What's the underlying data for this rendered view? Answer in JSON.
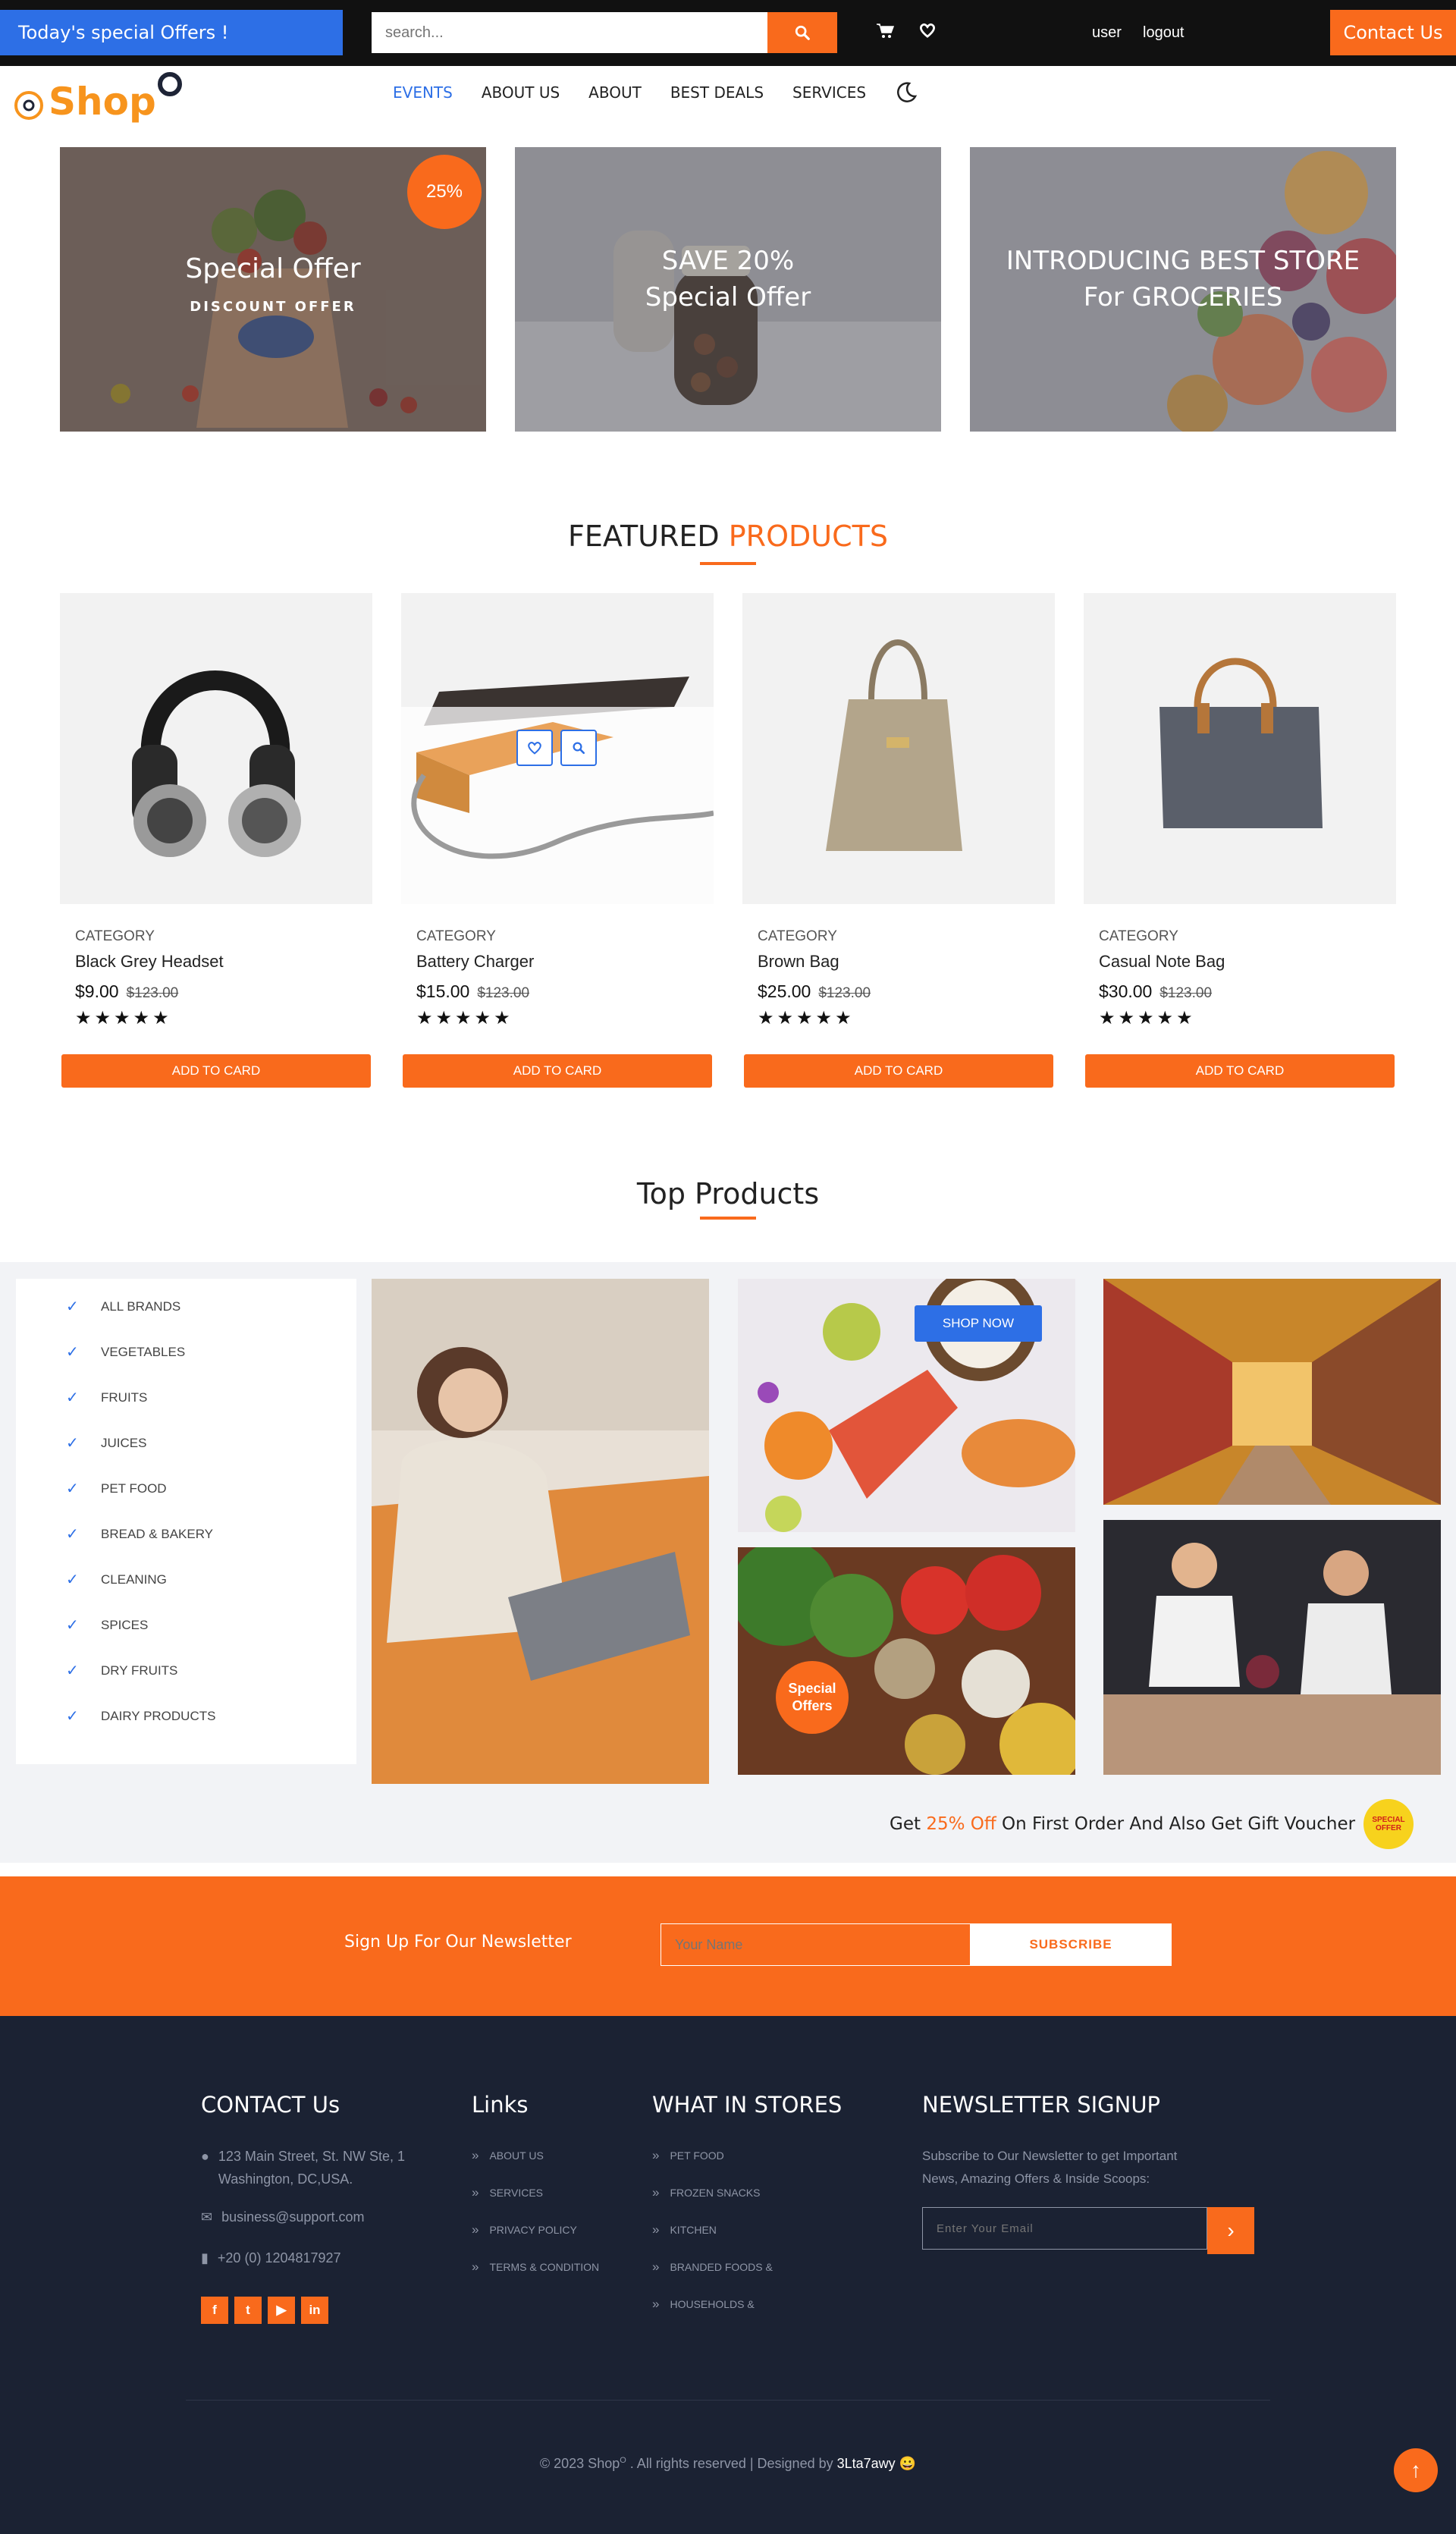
{
  "topbar": {
    "offer_tag": "Today's special Offers !",
    "search_placeholder": "search...",
    "user_label": "user",
    "logout_label": "logout",
    "contact_label": "Contact Us"
  },
  "nav": {
    "logo_text": "Shop",
    "items": [
      "EVENTS",
      "ABOUT US",
      "ABOUT",
      "BEST DEALS",
      "SERVICES"
    ],
    "active_item": "EVENTS"
  },
  "banners": [
    {
      "title": "Special Offer",
      "subtitle": "DISCOUNT OFFER",
      "badge": "25%"
    },
    {
      "title": "SAVE 20%",
      "subtitle": "Special Offer"
    },
    {
      "title": "INTRODUCING BEST STORE",
      "subtitle": "For GROCERIES"
    }
  ],
  "featured": {
    "title_part1": "FEATURED",
    "title_part2": "PRODUCTS",
    "products": [
      {
        "category": "CATEGORY",
        "name": "Black Grey Headset",
        "price": "$9.00",
        "old_price": "$123.00",
        "stars": "★★★★★",
        "button": "ADD TO CARD"
      },
      {
        "category": "CATEGORY",
        "name": "Battery Charger",
        "price": "$15.00",
        "old_price": "$123.00",
        "stars": "★★★★★",
        "button": "ADD TO CARD"
      },
      {
        "category": "CATEGORY",
        "name": "Brown Bag",
        "price": "$25.00",
        "old_price": "$123.00",
        "stars": "★★★★★",
        "button": "ADD TO CARD"
      },
      {
        "category": "CATEGORY",
        "name": "Casual Note Bag",
        "price": "$30.00",
        "old_price": "$123.00",
        "stars": "★★★★★",
        "button": "ADD TO CARD"
      }
    ]
  },
  "top_products": {
    "title": "Top Products",
    "categories": [
      "ALL BRANDS",
      "VEGETABLES",
      "FRUITS",
      "JUICES",
      "PET FOOD",
      "BREAD & BAKERY",
      "CLEANING",
      "SPICES",
      "DRY FRUITS",
      "DAIRY PRODUCTS"
    ],
    "shop_now": "SHOP NOW",
    "special_badge_line1": "Special",
    "special_badge_line2": "Offers",
    "promo_pre": "Get",
    "promo_highlight": "25% Off",
    "promo_post": "On First Order And Also Get Gift Voucher",
    "seal_line1": "SPECIAL",
    "seal_line2": "OFFER"
  },
  "newsletter": {
    "label": "Sign Up For Our Newsletter",
    "placeholder": "Your Name",
    "button": "SUBSCRIBE"
  },
  "footer": {
    "contact_title": "CONTACT Us",
    "address_line1": "123 Main Street, St. NW Ste, 1",
    "address_line2": "Washington, DC,USA.",
    "email": "business@support.com",
    "phone": "+20 (0) 1204817927",
    "links_title": "Links",
    "links": [
      "ABOUT US",
      "SERVICES",
      "PRIVACY POLICY",
      "TERMS & CONDITION"
    ],
    "stores_title": "WHAT IN STORES",
    "stores": [
      "PET FOOD",
      "FROZEN SNACKS",
      "KITCHEN",
      "BRANDED FOODS &",
      "HOUSEHOLDS &"
    ],
    "signup_title": "NEWSLETTER SIGNUP",
    "signup_text_line1": "Subscribe to Our Newsletter to get Important",
    "signup_text_line2": "News, Amazing Offers & Inside Scoops:",
    "email_placeholder": "Enter Your Email",
    "copyright_pre": "© 2023 Shop",
    "copyright_mid": " . All rights reserved | Designed by ",
    "designer": "3Lta7awy",
    "emoji": "😀"
  },
  "colors": {
    "accent": "#f96a1c",
    "primary": "#2d6fe6",
    "footer_bg": "#1b2233"
  }
}
